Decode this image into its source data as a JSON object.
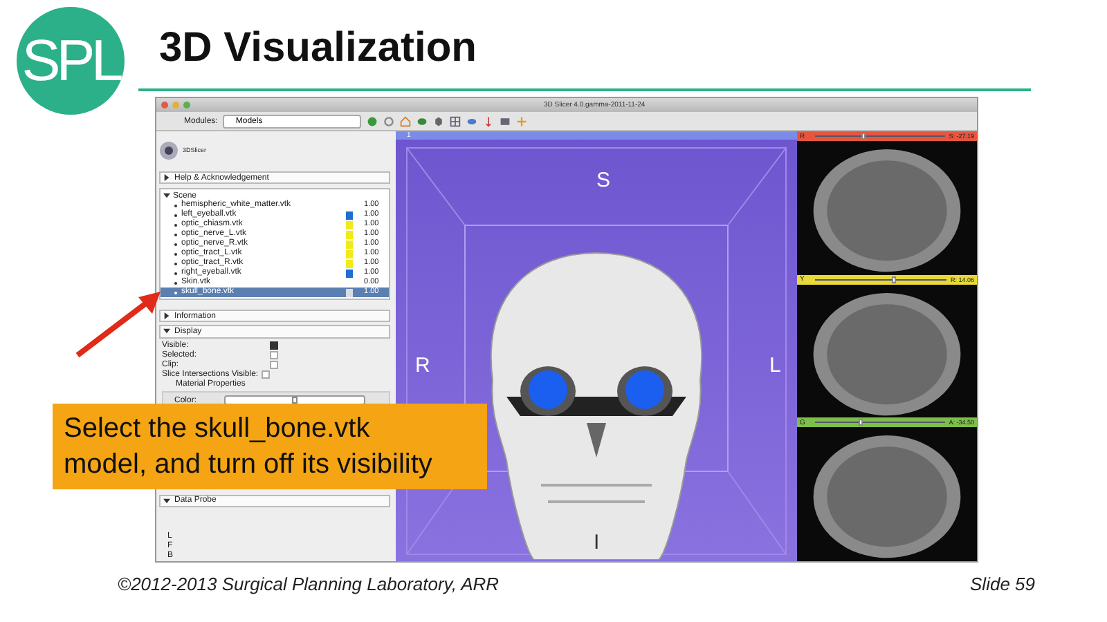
{
  "logo": {
    "text": "SPL"
  },
  "title": "3D Visualization",
  "app": {
    "window_title": "3D Slicer 4.0.gamma-2011-11-24",
    "modules_label": "Modules:",
    "module": "Models",
    "brand": "3DSlicer"
  },
  "help_section": {
    "label": "Help & Acknowledgement",
    "expanded": false
  },
  "scene": {
    "label": "Scene",
    "expanded": true,
    "children": [
      {
        "name": "hemispheric_white_matter.vtk",
        "opacity": "1.00",
        "selected": false
      },
      {
        "name": "left_eyeball.vtk",
        "color": "#1f6fd0",
        "opacity": "1.00",
        "selected": false
      },
      {
        "name": "optic_chiasm.vtk",
        "color": "#f2ea1a",
        "opacity": "1.00",
        "selected": false
      },
      {
        "name": "optic_nerve_L.vtk",
        "color": "#f2ea1a",
        "opacity": "1.00",
        "selected": false
      },
      {
        "name": "optic_nerve_R.vtk",
        "color": "#f2ea1a",
        "opacity": "1.00",
        "selected": false
      },
      {
        "name": "optic_tract_L.vtk",
        "color": "#f2ea1a",
        "opacity": "1.00",
        "selected": false
      },
      {
        "name": "optic_tract_R.vtk",
        "color": "#f2ea1a",
        "opacity": "1.00",
        "selected": false
      },
      {
        "name": "right_eyeball.vtk",
        "color": "#1f6fd0",
        "opacity": "1.00",
        "selected": false
      },
      {
        "name": "Skin.vtk",
        "opacity": "0.00",
        "selected": false
      },
      {
        "name": "skull_bone.vtk",
        "color": "#d8dde5",
        "opacity": "1.00",
        "selected": true
      }
    ]
  },
  "information": {
    "label": "Information",
    "expanded": false
  },
  "display": {
    "label": "Display",
    "expanded": true,
    "options": [
      {
        "label": "Visible:",
        "checked": true
      },
      {
        "label": "Selected:",
        "checked": false
      },
      {
        "label": "Clip:",
        "checked": false
      },
      {
        "label": "Slice Intersections Visible:",
        "checked": false
      }
    ],
    "material": "Material Properties",
    "color_label": "Color:",
    "color_slider": {
      "level": 0.5
    }
  },
  "data_probe": {
    "label": "Data Probe",
    "expanded": true,
    "lines": [
      "L",
      "F",
      "B"
    ]
  },
  "view3d": {
    "label": "1",
    "orientation": {
      "top": "S",
      "left": "R",
      "right": "L",
      "bottom": "I"
    }
  },
  "slices": [
    {
      "letter": "R",
      "color": "#e8553f",
      "level": 0.37,
      "reading": "S: -27.19"
    },
    {
      "letter": "Y",
      "color": "#e8d83a",
      "level": 0.6,
      "reading": "R: 14.06"
    },
    {
      "letter": "G",
      "color": "#7cc04a",
      "level": 0.35,
      "reading": "A: -34.50"
    }
  ],
  "callout": "Select the skull_bone.vtk\nmodel, and turn off its visibility",
  "footer": {
    "copyright": "©2012-2013 Surgical Planning Laboratory, ARR",
    "slide": "Slide 59"
  }
}
